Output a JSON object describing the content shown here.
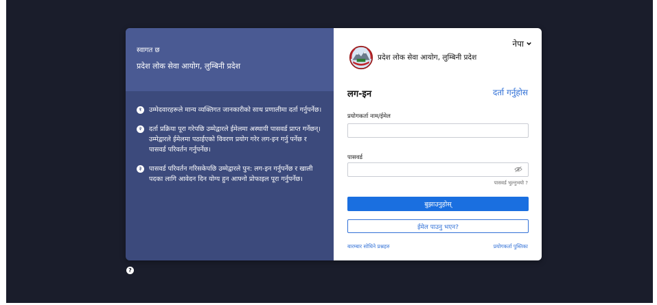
{
  "left_panel": {
    "welcome": "स्वागत छ",
    "org_name": "प्रदेश लोक सेवा आयोग, लुम्बिनी प्रदेश",
    "steps": [
      {
        "num": "१",
        "text": "उम्मेदवारहरूले मान्य व्यक्तिगत जानकारीको साथ प्रणालीमा दर्ता गर्नुपर्नेछ।"
      },
      {
        "num": "२",
        "text": "दर्ता प्रक्रिया पूरा गरेपछि उम्मेद्वारले ईमेलमा अस्थायी पासवर्ड प्राप्त गर्नेछन्। उम्मेद्वारले ईमेलमा पठाईएको विवरण प्रयोग गरेर लग-इन गर्नु पर्नेछ र पासवर्ड परिवर्तन गर्नुपर्नेछ।"
      },
      {
        "num": "३",
        "text": "पासवर्ड परिवर्तन गरिसकेपछि उम्मेद्वारले पुन: लग-इन गर्नुपर्नेछ र खाली पदका लागि आवेदन दिन योग्य हुन आफ्नो प्रोफाइल पूरा गर्नुपर्नेछ।"
      }
    ]
  },
  "right_panel": {
    "language": "नेपा",
    "brand_title": "प्रदेश लोक सेवा आयोग, लुम्बिनी प्रदेश",
    "login_title": "लग-इन",
    "register_link": "दर्ता गर्नुहोस",
    "username_label": "प्रयोगकर्ता नाम/ईमेल",
    "username_value": "",
    "password_label": "पासवर्ड",
    "password_value": "",
    "forgot_password": "पासवर्ड भुल्नुभयो ?",
    "submit_label": "बुझाउनुहोस्",
    "email_not_received": "ईमेल पाउनु भएन?",
    "faq_link": "बारम्बार सोधिने प्रश्नहरु",
    "manual_link": "प्रयोगकर्ता पुस्तिका"
  },
  "help_icon": "?",
  "colors": {
    "page_bg": "#1a1d2b",
    "left_panel": "#3c4a7c",
    "left_header": "#4a5a93",
    "primary": "#1a6fe0",
    "link": "#2f6fd6"
  },
  "icons": [
    "chevron-down-icon",
    "government-emblem-icon",
    "eye-slash-icon",
    "help-icon"
  ]
}
